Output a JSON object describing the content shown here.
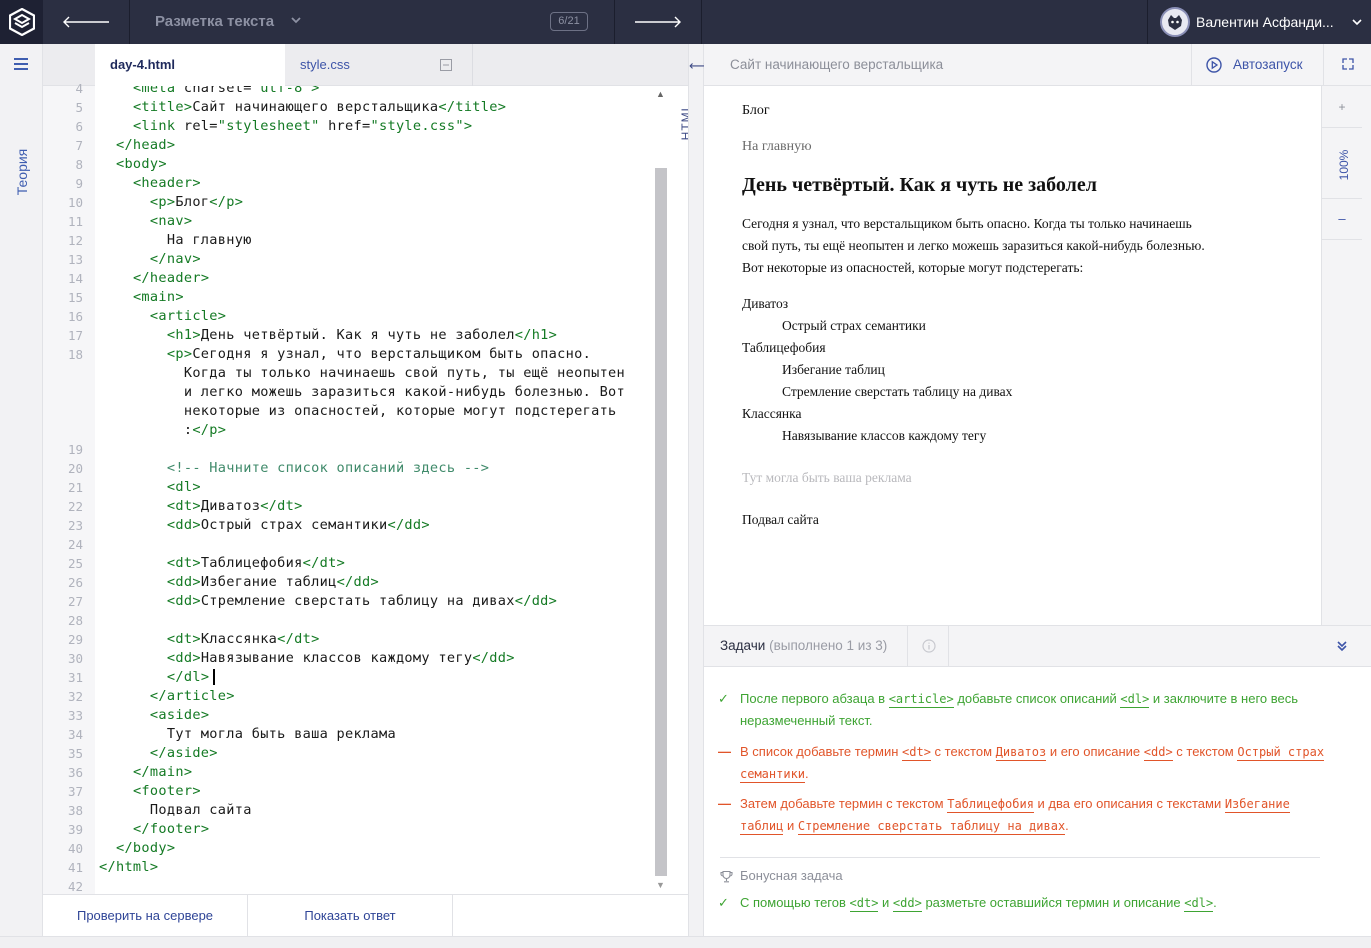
{
  "topbar": {
    "course_title": "Разметка текста",
    "progress": "6/21",
    "user_name": "Валентин Асфанди..."
  },
  "rail": {
    "theory_label": "Теория"
  },
  "editor": {
    "tabs": [
      {
        "label": "day-4.html"
      },
      {
        "label": "style.css"
      }
    ],
    "side_label": "HTML",
    "lines": [
      {
        "n": "4",
        "t": "    <meta charset=\"utf-8\">"
      },
      {
        "n": "5",
        "t": "    <title>Сайт начинающего верстальщика</title>"
      },
      {
        "n": "6",
        "t": "    <link rel=\"stylesheet\" href=\"style.css\">"
      },
      {
        "n": "7",
        "t": "  </head>"
      },
      {
        "n": "8",
        "t": "  <body>"
      },
      {
        "n": "9",
        "t": "    <header>"
      },
      {
        "n": "10",
        "t": "      <p>Блог</p>"
      },
      {
        "n": "11",
        "t": "      <nav>"
      },
      {
        "n": "12",
        "t": "        На главную"
      },
      {
        "n": "13",
        "t": "      </nav>"
      },
      {
        "n": "14",
        "t": "    </header>"
      },
      {
        "n": "15",
        "t": "    <main>"
      },
      {
        "n": "16",
        "t": "      <article>"
      },
      {
        "n": "17",
        "t": "        <h1>День четвёртый. Как я чуть не заболел</h1>"
      },
      {
        "n": "18",
        "t": "        <p>Сегодня я узнал, что верстальщиком быть опасно."
      },
      {
        "n": "",
        "t": "          Когда ты только начинаешь свой путь, ты ещё неопытен"
      },
      {
        "n": "",
        "t": "          и легко можешь заразиться какой-нибудь болезнью. Вот"
      },
      {
        "n": "",
        "t": "          некоторые из опасностей, которые могут подстерегать"
      },
      {
        "n": "",
        "t": "          :</p>"
      },
      {
        "n": "19",
        "t": ""
      },
      {
        "n": "20",
        "t": "        <!-- Начните список описаний здесь -->"
      },
      {
        "n": "21",
        "t": "        <dl>"
      },
      {
        "n": "22",
        "t": "        <dt>Диватоз</dt>"
      },
      {
        "n": "23",
        "t": "        <dd>Острый страх семантики</dd>"
      },
      {
        "n": "24",
        "t": ""
      },
      {
        "n": "25",
        "t": "        <dt>Таблицефобия</dt>"
      },
      {
        "n": "26",
        "t": "        <dd>Избегание таблиц</dd>"
      },
      {
        "n": "27",
        "t": "        <dd>Стремление сверстать таблицу на дивах</dd>"
      },
      {
        "n": "28",
        "t": ""
      },
      {
        "n": "29",
        "t": "        <dt>Классянка</dt>"
      },
      {
        "n": "30",
        "t": "        <dd>Навязывание классов каждому тегу</dd>"
      },
      {
        "n": "31",
        "t": "        </dl>"
      },
      {
        "n": "32",
        "t": "      </article>"
      },
      {
        "n": "33",
        "t": "      <aside>"
      },
      {
        "n": "34",
        "t": "        Тут могла быть ваша реклама"
      },
      {
        "n": "35",
        "t": "      </aside>"
      },
      {
        "n": "36",
        "t": "    </main>"
      },
      {
        "n": "37",
        "t": "    <footer>"
      },
      {
        "n": "38",
        "t": "      Подвал сайта"
      },
      {
        "n": "39",
        "t": "    </footer>"
      },
      {
        "n": "40",
        "t": "  </body>"
      },
      {
        "n": "41",
        "t": "</html>"
      },
      {
        "n": "42",
        "t": ""
      }
    ],
    "check_button": "Проверить на сервере",
    "answer_button": "Показать ответ"
  },
  "preview": {
    "title": "Сайт начинающего верстальщика",
    "autorun_label": "Автозапуск",
    "zoom_level": "100%",
    "zoom_plus": "+",
    "zoom_minus": "–",
    "content": {
      "blog": "Блог",
      "nav": "На главную",
      "h1": "День четвёртый. Как я чуть не заболел",
      "para": [
        "Сегодня я узнал, что верстальщиком быть опасно. Когда ты только начинаешь",
        "свой путь, ты ещё неопытен и легко можешь заразиться какой-нибудь болезнью.",
        "Вот некоторые из опасностей, которые могут подстерегать:"
      ],
      "dl": [
        {
          "type": "dt",
          "text": "Диватоз"
        },
        {
          "type": "dd",
          "text": "Острый страх семантики"
        },
        {
          "type": "dt",
          "text": "Таблицефобия"
        },
        {
          "type": "dd",
          "text": "Избегание таблиц"
        },
        {
          "type": "dd",
          "text": "Стремление сверстать таблицу на дивах"
        },
        {
          "type": "dt",
          "text": "Классянка"
        },
        {
          "type": "dd",
          "text": "Навязывание классов каждому тегу"
        }
      ],
      "aside": "Тут могла быть ваша реклама",
      "footer": "Подвал сайта"
    }
  },
  "tasks": {
    "title": "Задачи",
    "count": "(выполнено 1 из 3)",
    "items": [
      {
        "status": "done",
        "mark": "✓",
        "parts": [
          {
            "t": "После первого абзаца в "
          },
          {
            "c": "<article>"
          },
          {
            "t": " добавьте список описаний "
          },
          {
            "c": "<dl>"
          },
          {
            "t": " и заключите в него весь неразмеченный текст."
          }
        ]
      },
      {
        "status": "todo",
        "mark": "—",
        "parts": [
          {
            "t": "В список добавьте термин "
          },
          {
            "c": "<dt>"
          },
          {
            "t": " с текстом "
          },
          {
            "c": "Диватоз"
          },
          {
            "t": " и его описание "
          },
          {
            "c": "<dd>"
          },
          {
            "t": " с текстом "
          },
          {
            "c": "Острый страх семантики"
          },
          {
            "t": "."
          }
        ]
      },
      {
        "status": "todo",
        "mark": "—",
        "parts": [
          {
            "t": "Затем добавьте термин с текстом "
          },
          {
            "c": "Таблицефобия"
          },
          {
            "t": " и два его описания с текстами "
          },
          {
            "c": "Избегание таблиц"
          },
          {
            "t": " и "
          },
          {
            "c": "Стремление сверстать таблицу на дивах"
          },
          {
            "t": "."
          }
        ]
      }
    ],
    "bonus_title": "Бонусная задача",
    "bonus": {
      "status": "done",
      "mark": "✓",
      "parts": [
        {
          "t": "С помощью тегов "
        },
        {
          "c": "<dt>"
        },
        {
          "t": " и "
        },
        {
          "c": "<dd>"
        },
        {
          "t": " разметьте оставшийся термин и описание "
        },
        {
          "c": "<dl>"
        },
        {
          "t": "."
        }
      ]
    }
  },
  "colors": {
    "topbar": "#2b2f42",
    "accent": "#3d54a8",
    "done": "#3ea433",
    "todo": "#e1552a",
    "tag": "#147a24"
  }
}
